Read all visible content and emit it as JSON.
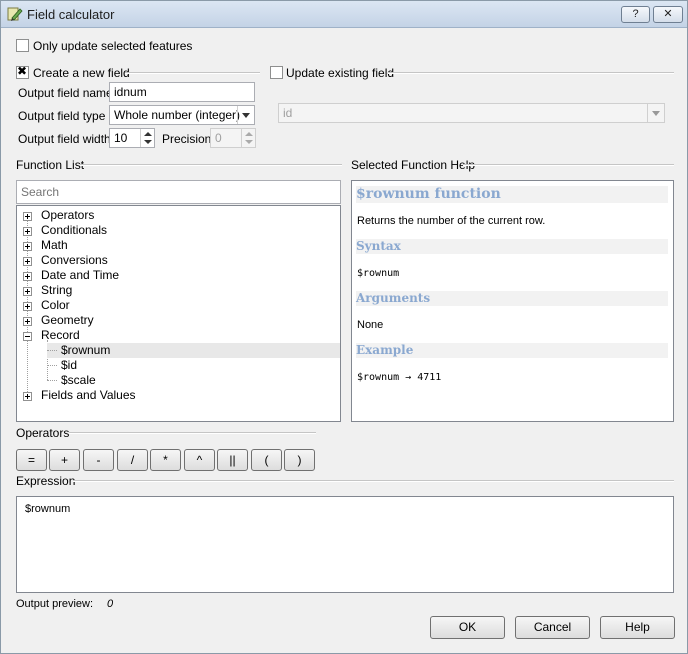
{
  "window": {
    "title": "Field calculator",
    "help_button": "?",
    "close_button": "✕"
  },
  "only_selected": {
    "label": "Only update selected features",
    "checked": false
  },
  "create_new": {
    "label": "Create a new field",
    "output_field_name_label": "Output field name",
    "output_field_name_value": "idnum",
    "output_field_type_label": "Output field type",
    "output_field_type_value": "Whole number (integer)",
    "output_field_width_label": "Output field width",
    "output_field_width_value": "10",
    "precision_label": "Precision",
    "precision_value": "0"
  },
  "update_existing": {
    "label": "Update existing field",
    "field_value": "id"
  },
  "function_list": {
    "label": "Function List",
    "search_placeholder": "Search",
    "items": [
      {
        "label": "Operators"
      },
      {
        "label": "Conditionals"
      },
      {
        "label": "Math"
      },
      {
        "label": "Conversions"
      },
      {
        "label": "Date and Time"
      },
      {
        "label": "String"
      },
      {
        "label": "Color"
      },
      {
        "label": "Geometry"
      },
      {
        "label": "Record"
      },
      {
        "label": "$rownum"
      },
      {
        "label": "$id"
      },
      {
        "label": "$scale"
      },
      {
        "label": "Fields and Values"
      }
    ]
  },
  "help": {
    "label": "Selected Function Help",
    "title": "$rownum function",
    "description": "Returns the number of the current row.",
    "syntax_heading": "Syntax",
    "syntax": "$rownum",
    "arguments_heading": "Arguments",
    "arguments": "None",
    "example_heading": "Example",
    "example": "$rownum → 4711"
  },
  "operators": {
    "label": "Operators",
    "buttons": [
      "=",
      "+",
      "-",
      "/",
      "*",
      "^",
      "||",
      "(",
      ")"
    ]
  },
  "expression": {
    "label": "Expression",
    "value": "$rownum"
  },
  "preview": {
    "label": "Output preview:",
    "value": "0"
  },
  "buttons": {
    "ok": "OK",
    "cancel": "Cancel",
    "help": "Help"
  }
}
